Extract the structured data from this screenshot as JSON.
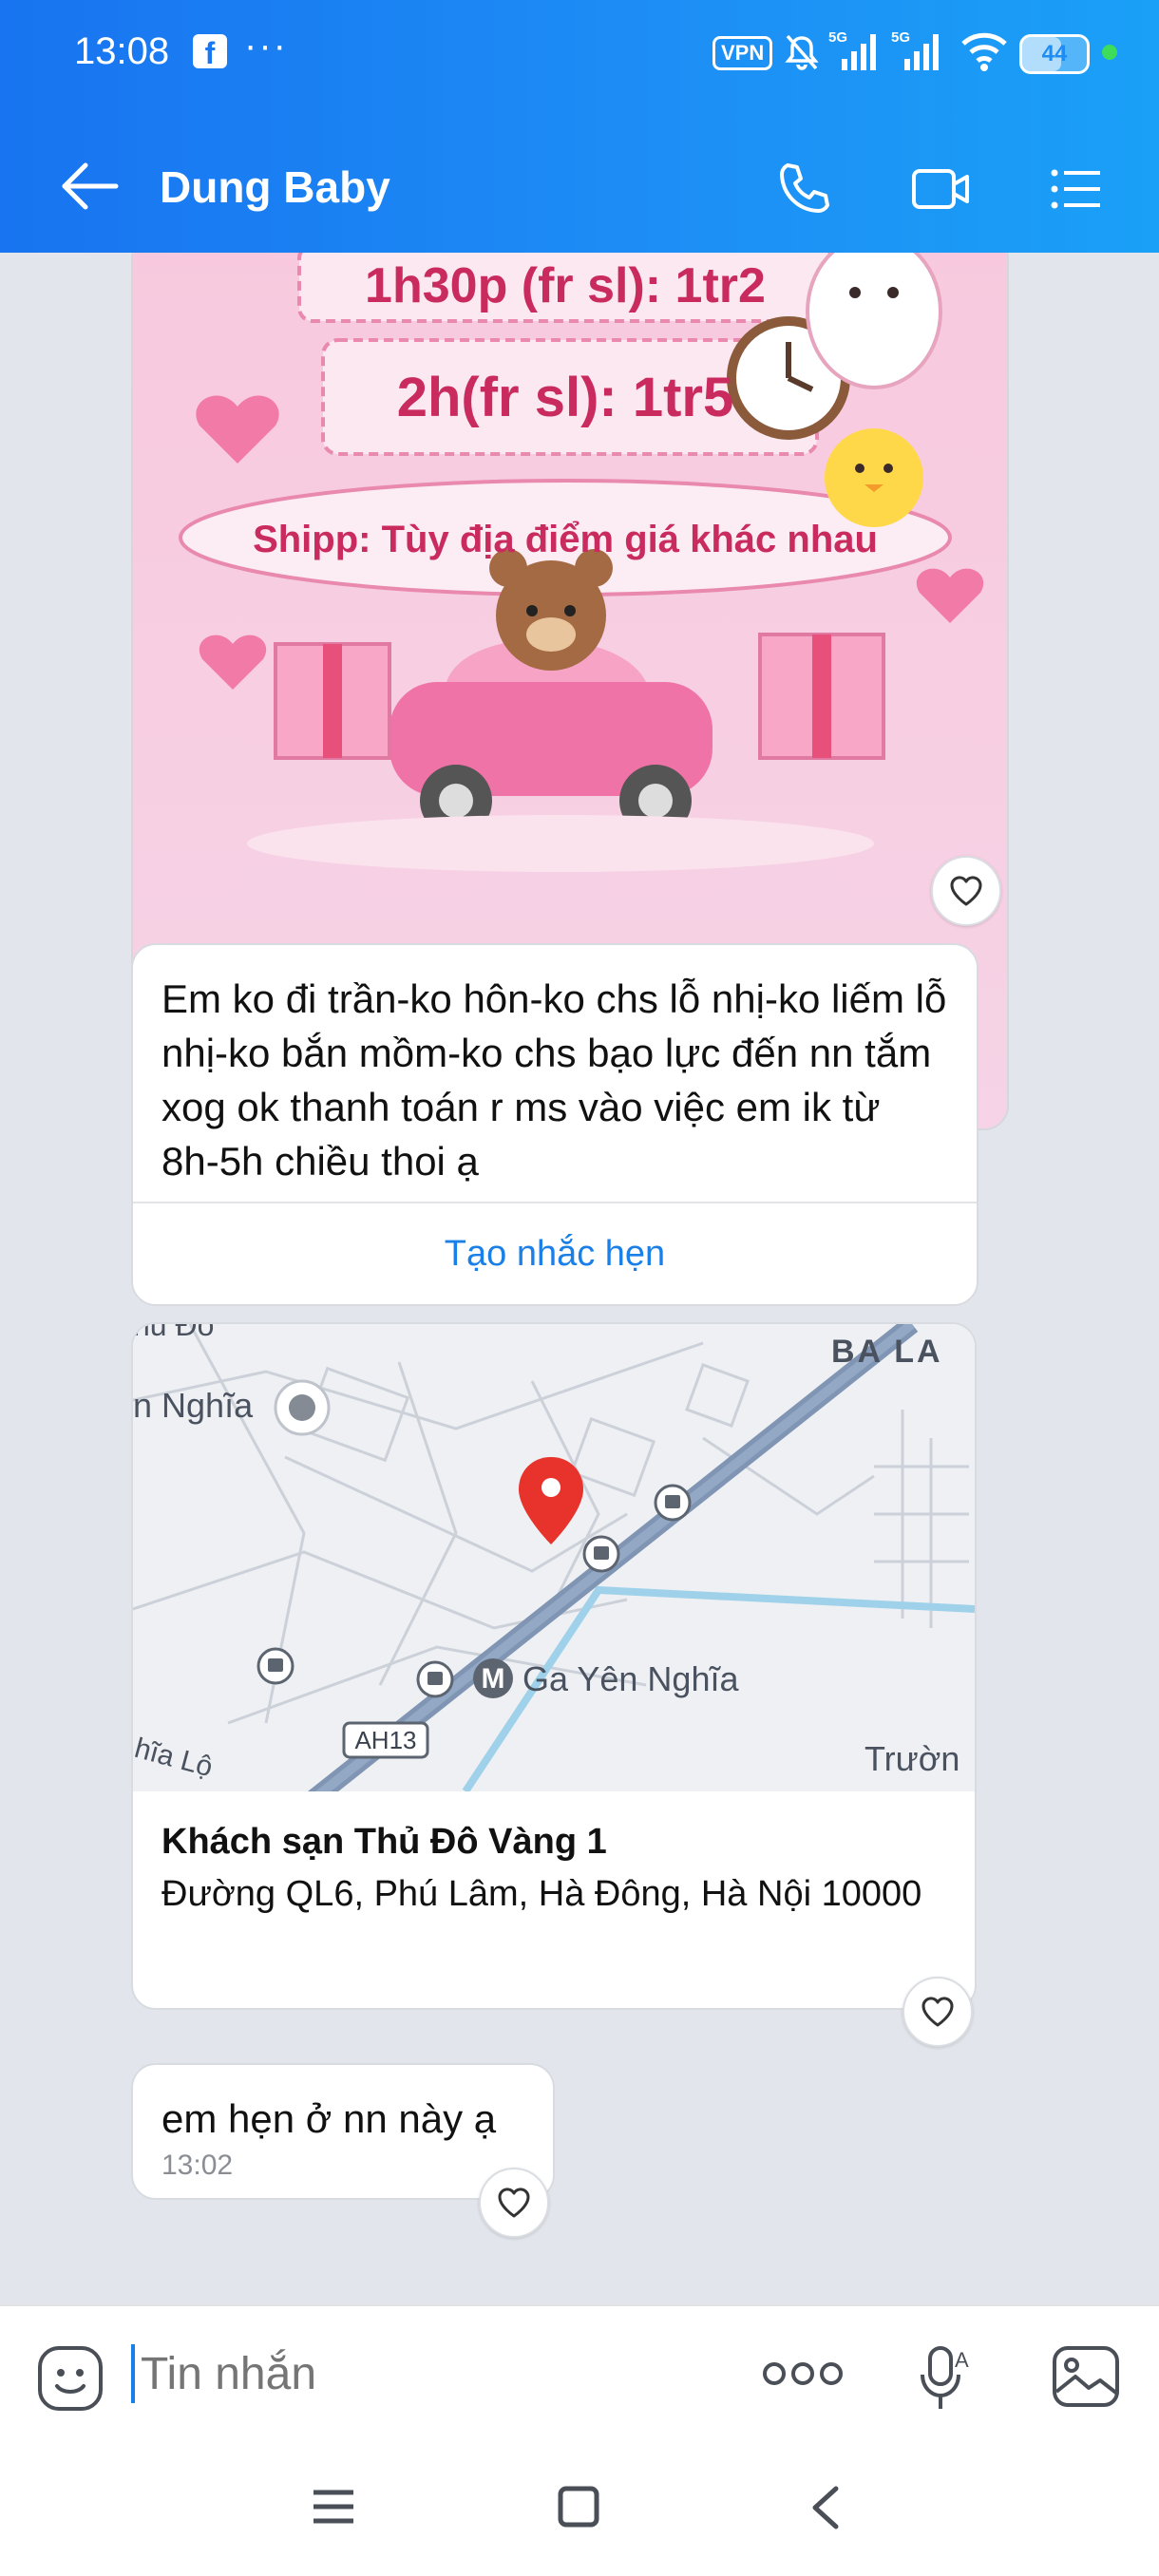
{
  "status_bar": {
    "time": "13:08",
    "app_badge": "f",
    "overflow": "···",
    "vpn": "VPN",
    "network_1": "5G",
    "network_2": "5G",
    "battery": "44"
  },
  "header": {
    "contact_name": "Dung Baby"
  },
  "messages": {
    "image_card": {
      "line_1": "1h30p (fr sl): 1tr2",
      "line_2": "2h(fr sl): 1tr5",
      "line_3": "Shipp: Tùy địa điểm giá khác nhau"
    },
    "text_1": "Em ko đi trần-ko hôn-ko chs lỗ nhị-ko liếm lỗ nhị-ko bắn mồm-ko chs bạo lực đến nn tắm xog ok thanh toán r ms vào việc em ik từ 8h-5h chiều thoi ạ",
    "reminder_label": "Tạo nhắc hẹn",
    "location": {
      "map_labels": {
        "area_top_right": "BA LA",
        "area_left": "n Nghĩa",
        "area_top_left": "hủ Đô",
        "station": "Ga Yên Nghĩa",
        "metro_letter": "M",
        "highway": "AH13",
        "road_left": "hĩa Lộ",
        "school": "Trườn"
      },
      "title": "Khách sạn Thủ Đô Vàng 1",
      "address": "Đường QL6, Phú Lâm, Hà Đông, Hà Nội 10000"
    },
    "text_2": "em hẹn ở nn này ạ",
    "text_2_time": "13:02"
  },
  "input": {
    "placeholder": "Tin nhắn"
  },
  "colors": {
    "header_blue": "#1d8df5",
    "accent": "#1a7fe6",
    "chat_bg": "#e2e6ec"
  }
}
